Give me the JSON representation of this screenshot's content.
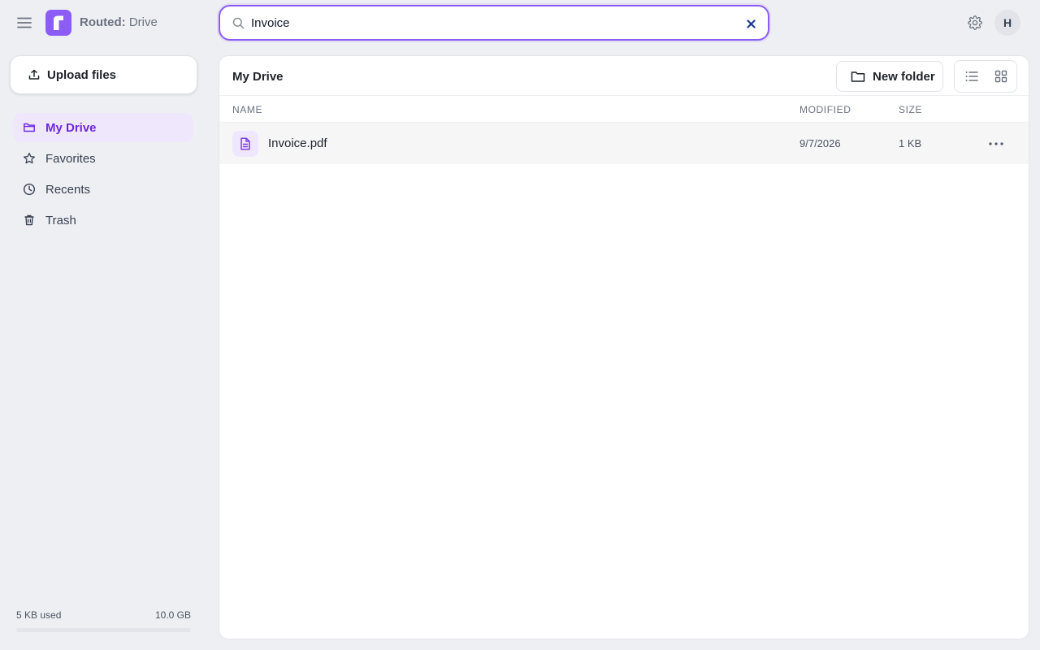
{
  "app": {
    "brand_bold": "Routed:",
    "brand_rest": " Drive",
    "logo_letter": "r",
    "accent_color": "#8b5cf6"
  },
  "topbar": {
    "menu_icon": "hamburger-menu-icon",
    "search_icon": "search-icon",
    "search_value": "Invoice",
    "clear_icon": "close-icon",
    "settings_icon": "gear-icon",
    "avatar_initial": "H"
  },
  "sidebar": {
    "upload_label": "Upload files",
    "upload_icon": "upload-icon",
    "items": [
      {
        "label": "My Drive",
        "icon": "folder-icon",
        "active": true
      },
      {
        "label": "Favorites",
        "icon": "star-icon",
        "active": false
      },
      {
        "label": "Recents",
        "icon": "clock-icon",
        "active": false
      },
      {
        "label": "Trash",
        "icon": "trash-icon",
        "active": false
      }
    ],
    "storage": {
      "used": "5 KB used",
      "total": "10.0 GB",
      "fraction_used": 0
    }
  },
  "main": {
    "title": "My Drive",
    "new_folder_label": "New folder",
    "view_icons": [
      "list-view-icon",
      "grid-view-icon"
    ],
    "columns": {
      "name": "NAME",
      "modified": "MODIFIED",
      "size": "SIZE"
    },
    "files": [
      {
        "name": "Invoice.pdf",
        "modified": "9/7/2026",
        "size": "1 KB",
        "icon": "file-document-icon"
      }
    ]
  }
}
